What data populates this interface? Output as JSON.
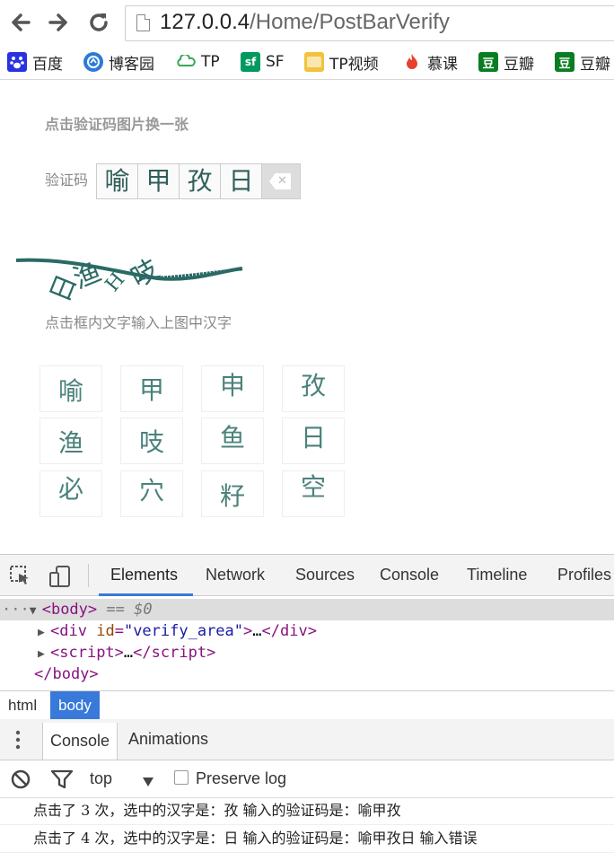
{
  "browser": {
    "url_host": "127.0.0.4",
    "url_path": "/Home/PostBarVerify",
    "bookmarks": [
      {
        "label": "百度",
        "icon": "paw-icon",
        "color": "#2932e1"
      },
      {
        "label": "博客园",
        "icon": "blog-icon",
        "color": "#2b7bd6"
      },
      {
        "label": "TP",
        "icon": "cloud-icon",
        "color": "#3aa757"
      },
      {
        "label": "SF",
        "icon": "sf-icon",
        "color": "#009a61"
      },
      {
        "label": "TP视频",
        "icon": "folder-icon",
        "color": "#f2c33a"
      },
      {
        "label": "慕课",
        "icon": "flame-icon",
        "color": "#e8402e"
      },
      {
        "label": "豆瓣",
        "icon": "douban-icon",
        "color": "#0a7d23"
      },
      {
        "label": "豆瓣",
        "icon": "douban-icon",
        "color": "#0a7d23"
      }
    ]
  },
  "page": {
    "refresh_hint": "点击验证码图片换一张",
    "code_label": "验证码",
    "entered_chars": [
      "喻",
      "甲",
      "孜",
      "日"
    ],
    "delete_glyph": "✕",
    "captcha_chars": [
      "日",
      "渔",
      "H",
      "吱"
    ],
    "instruction": "点击框内文字输入上图中汉字",
    "char_grid": [
      "喻",
      "甲",
      "申",
      "孜",
      "渔",
      "吱",
      "鱼",
      "日",
      "必",
      "穴",
      "籽",
      "空"
    ]
  },
  "devtools": {
    "tabs": [
      "Elements",
      "Network",
      "Sources",
      "Console",
      "Timeline",
      "Profiles"
    ],
    "dom": {
      "body_open": "<body>",
      "selected_marker": "== $0",
      "div_tag": "div",
      "div_attr": "id",
      "div_value": "\"verify_area\"",
      "ellipsis": "…",
      "script_tag": "script",
      "body_close": "</body>"
    },
    "breadcrumbs": [
      "html",
      "body"
    ],
    "drawer_tabs": [
      "Console",
      "Animations"
    ],
    "console_toolbar": {
      "context": "top",
      "preserve_log": "Preserve log"
    },
    "console_lines": [
      "点击了 3 次，选中的汉字是：孜 输入的验证码是：喻甲孜",
      "点击了 4 次，选中的汉字是：日 输入的验证码是：喻甲孜日 输入错误"
    ]
  }
}
